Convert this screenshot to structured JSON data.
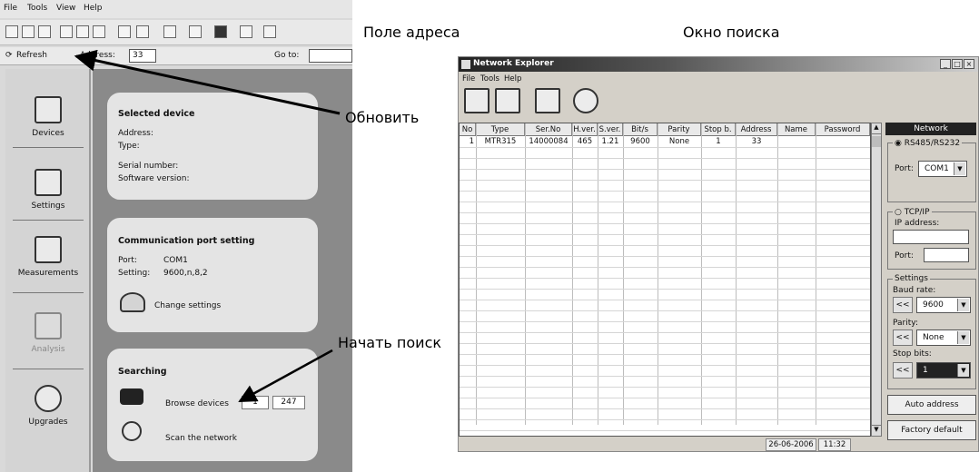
{
  "left_app": {
    "menu": [
      "File",
      "Tools",
      "View",
      "Help"
    ],
    "refresh_label": "Refresh",
    "address_label": "Address:",
    "address_value": "33",
    "goto_label": "Go to:",
    "goto_value": "",
    "sidebar": [
      "Devices",
      "Settings",
      "Measurements",
      "Analysis",
      "Upgrades"
    ],
    "selected_device": {
      "title": "Selected device",
      "address_label": "Address:",
      "type_label": "Type:",
      "serial_label": "Serial number:",
      "software_label": "Software version:"
    },
    "comm_port": {
      "title": "Communication port setting",
      "port_label": "Port:",
      "port_value": "COM1",
      "setting_label": "Setting:",
      "setting_value": "9600,n,8,2",
      "change_label": "Change settings"
    },
    "searching": {
      "title": "Searching",
      "browse_label": "Browse devices",
      "from": "1",
      "to": "247",
      "scan_label": "Scan the network"
    }
  },
  "annotations": {
    "address_field": "Поле адреса",
    "search_window": "Окно поиска",
    "refresh": "Обновить",
    "start_search": "Начать поиск"
  },
  "network_explorer": {
    "title": "Network Explorer",
    "menu": [
      "File",
      "Tools",
      "Help"
    ],
    "columns": [
      "No",
      "Type",
      "Ser.No",
      "H.ver.",
      "S.ver.",
      "Bit/s",
      "Parity",
      "Stop b.",
      "Address",
      "Name",
      "Password"
    ],
    "rows": [
      [
        "1",
        "MTR315",
        "14000084",
        "465",
        "1.21",
        "9600",
        "None",
        "1",
        "33",
        "",
        ""
      ]
    ],
    "status_date": "26-06-2006",
    "status_time": "11:32",
    "panel": {
      "title": "Network",
      "rs485_label": "RS485/RS232",
      "port_label": "Port:",
      "port_value": "COM1",
      "tcpip_label": "TCP/IP",
      "ip_label": "IP address:",
      "ip_value": "",
      "tcp_port_label": "Port:",
      "tcp_port_value": "",
      "settings_label": "Settings",
      "baud_label": "Baud rate:",
      "baud_value": "9600",
      "parity_label": "Parity:",
      "parity_value": "None",
      "stop_label": "Stop bits:",
      "stop_value": "1",
      "prev_symbol": "<<",
      "auto_address": "Auto address",
      "factory_default": "Factory default"
    }
  },
  "colors": {
    "app_bg": "#d9d9d9",
    "panel_bg": "#8a8a8a",
    "card_bg": "#e4e4e4",
    "window_bg": "#d4d0c8",
    "selection": "#222222"
  }
}
